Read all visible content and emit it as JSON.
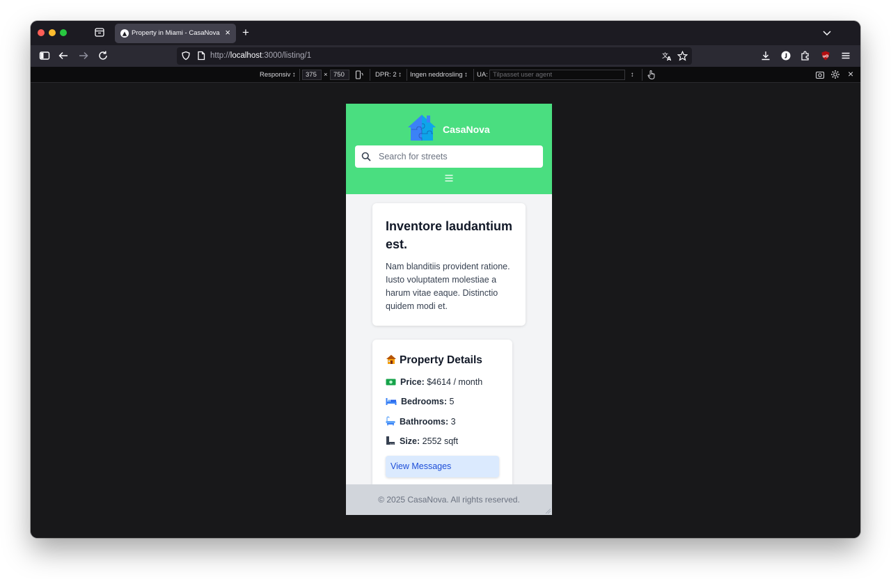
{
  "browser": {
    "tab_title": "Property in Miami - CasaNova",
    "url_prefix": "http://",
    "url_host": "localhost",
    "url_rest": ":3000/listing/1"
  },
  "devtools": {
    "responsive_label": "Responsiv ↕",
    "width_value": "375",
    "times_sign": "×",
    "height_value": "750",
    "dpr_label": "DPR: 2 ↕",
    "throttling_label": "Ingen neddrosling ↕",
    "ua_label": "UA:",
    "ua_placeholder": "Tilpasset user agent",
    "ua_arrow": "↕"
  },
  "site": {
    "brand": "CasaNova",
    "search_placeholder": "Search for streets",
    "description_card": {
      "title": "Inventore laudantium est.",
      "text": "Nam blanditiis provident ratione. Iusto voluptatem molestiae a harum vitae eaque. Distinctio quidem modi et."
    },
    "details_card": {
      "title": "Property Details",
      "rows": [
        {
          "label": "Price:",
          "value": "$4614 / month",
          "icon": "money-icon"
        },
        {
          "label": "Bedrooms:",
          "value": "5",
          "icon": "bed-icon"
        },
        {
          "label": "Bathrooms:",
          "value": "3",
          "icon": "bathtub-icon"
        },
        {
          "label": "Size:",
          "value": "2552 sqft",
          "icon": "ruler-icon"
        }
      ],
      "button_label": "View Messages"
    },
    "footer": "© 2025 CasaNova. All rights reserved."
  },
  "colors": {
    "header_green": "#4ade80",
    "button_bg": "#dbeafe",
    "button_text": "#1d4ed8",
    "footer_bg": "#d1d5db",
    "page_bg": "#f3f4f6"
  }
}
